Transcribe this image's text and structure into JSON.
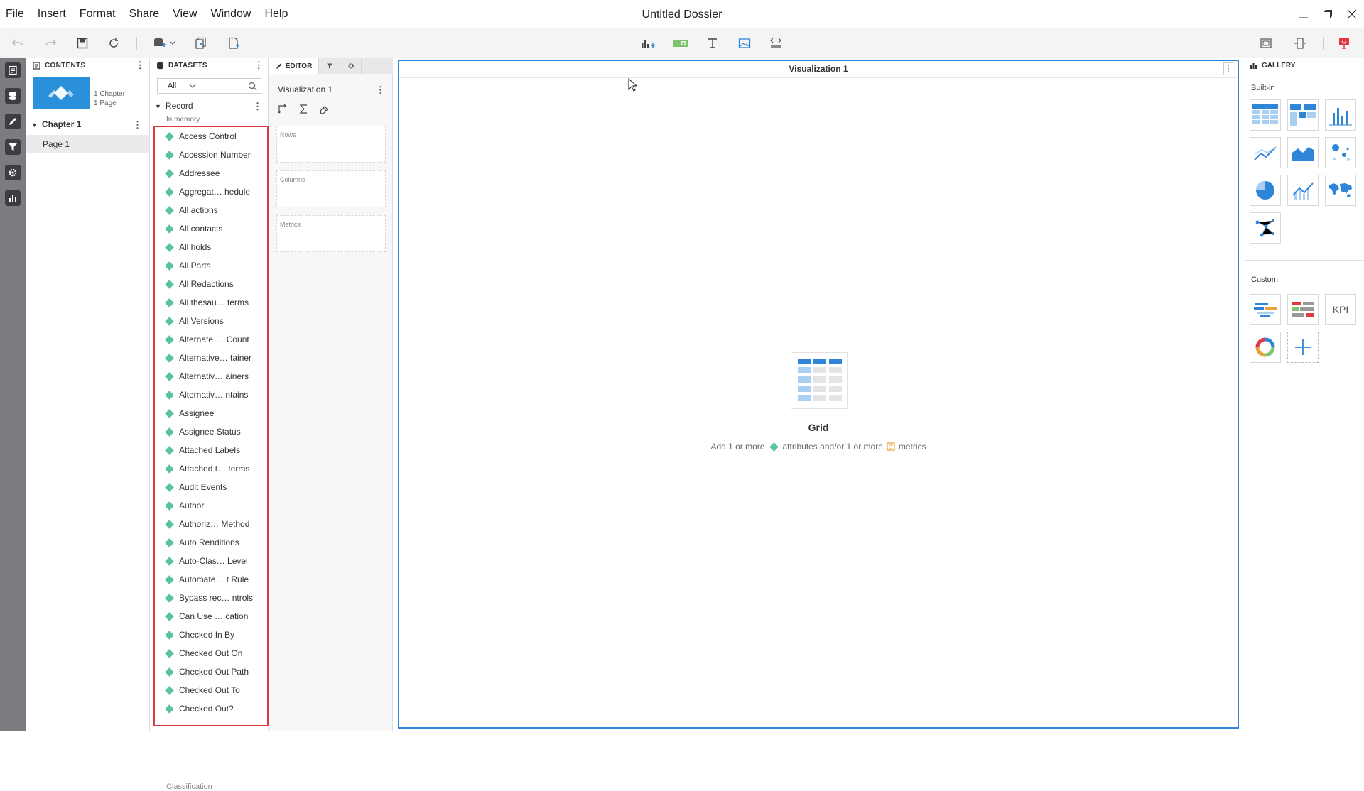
{
  "menu": [
    "File",
    "Insert",
    "Format",
    "Share",
    "View",
    "Window",
    "Help"
  ],
  "window_title": "Untitled Dossier",
  "contents": {
    "header": "CONTENTS",
    "chapter_count": "1 Chapter",
    "page_count": "1 Page",
    "chapter_name": "Chapter 1",
    "page_name": "Page 1"
  },
  "datasets": {
    "header": "DATASETS",
    "filter_value": "All",
    "dataset_name": "Record",
    "storage": "In memory",
    "attributes": [
      "Access Control",
      "Accession Number",
      "Addressee",
      "Aggregat… hedule",
      "All actions",
      "All contacts",
      "All holds",
      "All Parts",
      "All Redactions",
      "All thesau…  terms",
      "All Versions",
      "Alternate …  Count",
      "Alternative… tainer",
      "Alternativ…  ainers",
      "Alternativ…  ntains",
      "Assignee",
      "Assignee Status",
      "Attached Labels",
      "Attached t…  terms",
      "Audit Events",
      "Author",
      "Authoriz…  Method",
      "Auto Renditions",
      "Auto-Clas…  Level",
      "Automate…  t Rule",
      "Bypass rec… ntrols",
      "Can Use …  cation",
      "Checked In By",
      "Checked Out On",
      "Checked Out Path",
      "Checked Out To",
      "Checked Out?"
    ],
    "next_attribute": "Classification"
  },
  "editor": {
    "tab_label": "EDITOR",
    "viz_name": "Visualization 1",
    "rows_label": "Rows",
    "columns_label": "Columns",
    "metrics_label": "Metrics"
  },
  "canvas": {
    "title": "Visualization 1",
    "placeholder_title": "Grid",
    "hint_part1": "Add 1 or more",
    "hint_part2": "attributes and/or 1 or more",
    "hint_part3": "metrics"
  },
  "gallery": {
    "header": "GALLERY",
    "builtin_label": "Built-in",
    "custom_label": "Custom",
    "kpi_label": "KPI",
    "accent": "#2f86d8"
  }
}
